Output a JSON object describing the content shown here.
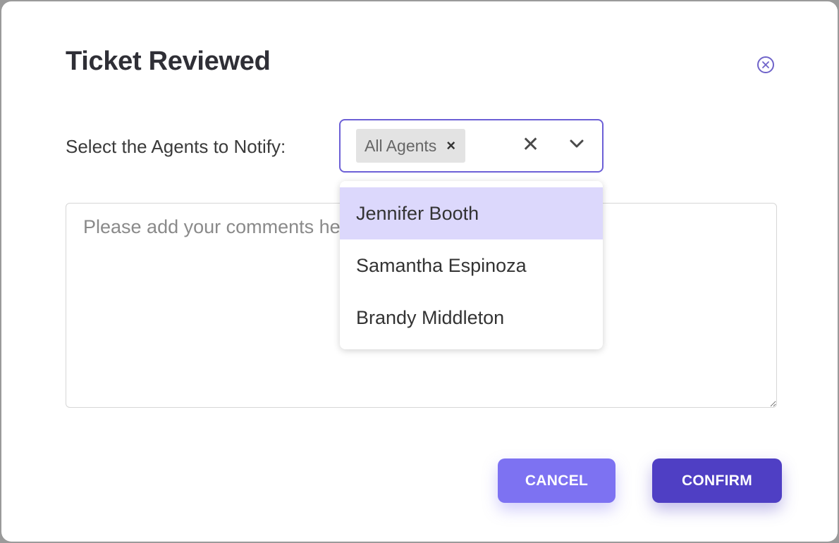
{
  "dialog": {
    "title": "Ticket Reviewed",
    "close_icon": "close-circle-icon"
  },
  "agents_select": {
    "label": "Select the Agents to Notify:",
    "selected_chip": "All Agents",
    "chip_remove_glyph": "×",
    "clear_glyph": "✕",
    "options": [
      {
        "label": "Jennifer Booth",
        "highlighted": true
      },
      {
        "label": "Samantha Espinoza",
        "highlighted": false
      },
      {
        "label": "Brandy Middleton",
        "highlighted": false
      }
    ]
  },
  "comments": {
    "placeholder": "Please add your comments here",
    "value": ""
  },
  "buttons": {
    "cancel": "CANCEL",
    "confirm": "CONFIRM"
  },
  "colors": {
    "accent": "#6c5fd6",
    "cancel_bg": "#7d72f2",
    "confirm_bg": "#4f3fc4",
    "highlight_bg": "#dcd8fc"
  }
}
